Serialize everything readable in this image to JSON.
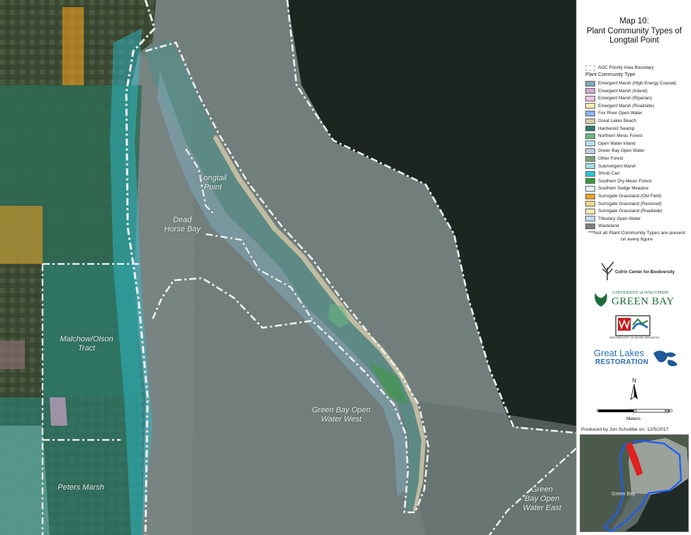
{
  "title": {
    "line1": "Map 10:",
    "line2": "Plant Community Types of",
    "line3": "Longtail Point"
  },
  "map_labels": {
    "longtail_point": [
      "Longtail",
      "Point"
    ],
    "dead_horse_bay": [
      "Dead",
      "Horse Bay"
    ],
    "malchow_olson": [
      "Malchow/Olson",
      "Tract"
    ],
    "peters_marsh": [
      "Peters Marsh"
    ],
    "gb_west": [
      "Green Bay Open",
      "Water West"
    ],
    "gb_east": [
      "Green",
      "Bay Open",
      "Water East"
    ]
  },
  "legend": {
    "boundary_label": "AOC Priority Area Boundary",
    "header": "Plant Community Type",
    "items": [
      {
        "label": "Emergent Marsh (High Energy Coastal)",
        "color": "#7fa8b8"
      },
      {
        "label": "Emergent Marsh (Inland)",
        "color": "#d8a6d0"
      },
      {
        "label": "Emergent Marsh (Riparian)",
        "color": "#f0c0e0"
      },
      {
        "label": "Emergent Marsh (Roadside)",
        "color": "#f6f0b0"
      },
      {
        "label": "Fox River Open Water",
        "color": "#8ab4f0"
      },
      {
        "label": "Great Lakes Beach",
        "color": "#d8c8a8"
      },
      {
        "label": "Hardwood Swamp",
        "color": "#2d7a6a"
      },
      {
        "label": "Northern Mesic Forest",
        "color": "#6ab880"
      },
      {
        "label": "Open Water Inland",
        "color": "#b8e4f4"
      },
      {
        "label": "Green Bay Open Water",
        "color": "#c4cce8"
      },
      {
        "label": "Other Forest",
        "color": "#78a878"
      },
      {
        "label": "Submergent Marsh",
        "color": "#9ee0e0"
      },
      {
        "label": "Shrub Carr",
        "color": "#2cc6d6"
      },
      {
        "label": "Southern Dry-Mesic Forest",
        "color": "#3a9a3a"
      },
      {
        "label": "Southern Sedge Meadow",
        "color": "#e8f4f4"
      },
      {
        "label": "Surrogate Grassland (Old Field)",
        "color": "#f0a020"
      },
      {
        "label": "Surrogate Grassland (Restored)",
        "color": "#f4d890"
      },
      {
        "label": "Surrogate Grassland (Roadside)",
        "color": "#f4ecb0"
      },
      {
        "label": "Tributary Open Water",
        "color": "#c0dcf4"
      },
      {
        "label": "Wasteland",
        "color": "#808080"
      }
    ],
    "note": "***Not all Plant Community Types are present on every figure"
  },
  "logos": {
    "cofrin_text": "Cofrin Center for Biodiversity",
    "uw_line1": "UNIVERSITY of WISCONSIN",
    "uw_line2": "GREEN BAY",
    "wdnr_text": "WISCONSIN DEPT. OF NATURAL RESOURCES",
    "glr_line1": "Great Lakes",
    "glr_line2": "RESTORATION"
  },
  "scale": {
    "north": "N",
    "ticks": [
      "0",
      "345",
      "690"
    ],
    "unit": "Meters"
  },
  "credit": "Produced by Jon Schubbe on: 12/5/2017",
  "inset": {
    "label": "Green Bay"
  },
  "colors": {
    "lake_dark": "#1b2621",
    "bay_water": "#6e7b79",
    "boundary": "#f2f2f2",
    "priority_highlight": "#e02020",
    "inset_boundary": "#1a5cff"
  }
}
